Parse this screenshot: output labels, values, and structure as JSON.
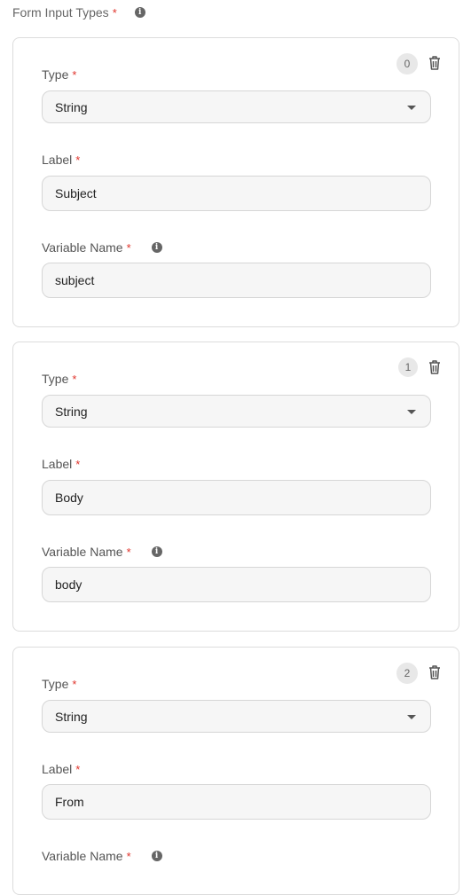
{
  "header": {
    "title": "Form Input Types",
    "required_mark": "*",
    "info_icon": "info-icon"
  },
  "labels": {
    "type": "Type",
    "label": "Label",
    "variable_name": "Variable Name",
    "required_mark": "*"
  },
  "items": [
    {
      "index": "0",
      "type": "String",
      "label": "Subject",
      "variable_name": "subject"
    },
    {
      "index": "1",
      "type": "String",
      "label": "Body",
      "variable_name": "body"
    },
    {
      "index": "2",
      "type": "String",
      "label": "From",
      "variable_name": ""
    }
  ],
  "icons": {
    "delete": "trash-icon",
    "dropdown": "caret-down-icon",
    "info": "info-icon"
  },
  "colors": {
    "required": "#e0342c",
    "border": "#dcdcdc",
    "field_bg": "#f6f6f6"
  }
}
